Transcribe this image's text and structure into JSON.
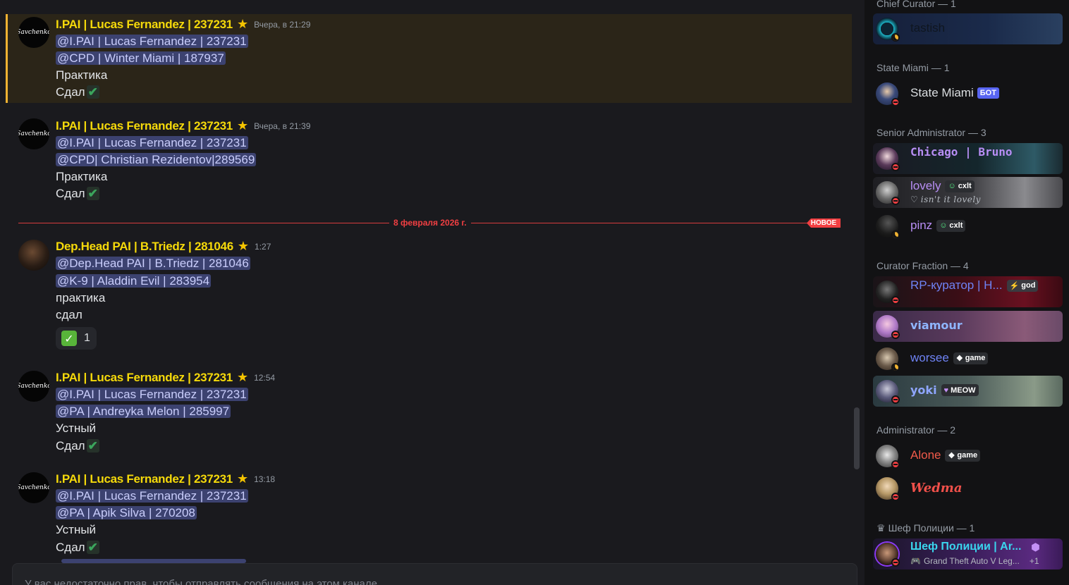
{
  "messages": [
    {
      "author": "I.PAI | Lucas Fernandez | 237231",
      "time": "Вчера, в 21:29",
      "avatar_text": "Savchenko",
      "lines": [
        "@I.PAI | Lucas Fernandez | 237231",
        "@CPD | Winter Miami | 187937",
        "Практика",
        "Сдал"
      ]
    },
    {
      "author": "I.PAI | Lucas Fernandez | 237231",
      "time": "Вчера, в 21:39",
      "avatar_text": "Savchenko",
      "lines": [
        "@I.PAI | Lucas Fernandez | 237231",
        "@CPD| Christian Rezidentov|289569",
        "Практика",
        "Сдал"
      ]
    },
    {
      "author": "Dep.Head PAI | B.Triedz | 281046",
      "time": "1:27",
      "lines": [
        "@Dep.Head PAI | B.Triedz | 281046",
        "@K-9 | Aladdin Evil | 283954",
        "практика",
        "сдал"
      ],
      "reaction": {
        "emoji": "✓",
        "count": "1"
      }
    },
    {
      "author": "I.PAI | Lucas Fernandez | 237231",
      "time": "12:54",
      "avatar_text": "Savchenko",
      "lines": [
        "@I.PAI | Lucas Fernandez | 237231",
        "@PA | Andreyka Melon | 285997",
        "Устный",
        "Сдал"
      ]
    },
    {
      "author": "I.PAI | Lucas Fernandez | 237231",
      "time": "13:18",
      "avatar_text": "Savchenko",
      "lines": [
        "@I.PAI | Lucas Fernandez | 237231",
        "@PA | Apik Silva | 270208",
        "Устный",
        "Сдал"
      ]
    }
  ],
  "divider": {
    "date": "8 февраля 2026 г.",
    "new_label": "НОВОЕ"
  },
  "input": {
    "placeholder": "У вас недостаточно прав, чтобы отправлять сообщения на этом канале."
  },
  "members": {
    "cats": {
      "chief": "Chief Curator — 1",
      "state": "State Miami — 1",
      "senior": "Senior Administrator — 3",
      "curator": "Curator Fraction — 4",
      "admin": "Administrator — 2",
      "police": "Шеф Полиции — 1"
    },
    "list": {
      "tastish": {
        "name": "tastish"
      },
      "statemiami": {
        "name": "State Miami",
        "badge": "БОТ"
      },
      "chicago": {
        "name": "Chicago | Bruno"
      },
      "lovely": {
        "name": "lovely",
        "tag": "cxlt",
        "status": "isn't it lovely"
      },
      "pinz": {
        "name": "pinz",
        "tag": "cxlt"
      },
      "rp": {
        "name": "RP-куратор | H...",
        "tag": "god"
      },
      "viamour": {
        "name": "viamour"
      },
      "worsee": {
        "name": "worsee",
        "tag": "game"
      },
      "yoki": {
        "name": "yoki",
        "tag": "MEOW"
      },
      "alone": {
        "name": "Alone",
        "tag": "game"
      },
      "wedma": {
        "name": "Wedma"
      },
      "chief_police": {
        "name": "Шеф Полиции | Ar...",
        "activity": "Grand Theft Auto V Leg...",
        "extra": "+1"
      }
    }
  },
  "colors": {
    "author": "#f5d90a",
    "mention_bg": "#3c4270",
    "new_red": "#f23f42",
    "dnd": "#f23f42",
    "idle": "#f0b232"
  }
}
